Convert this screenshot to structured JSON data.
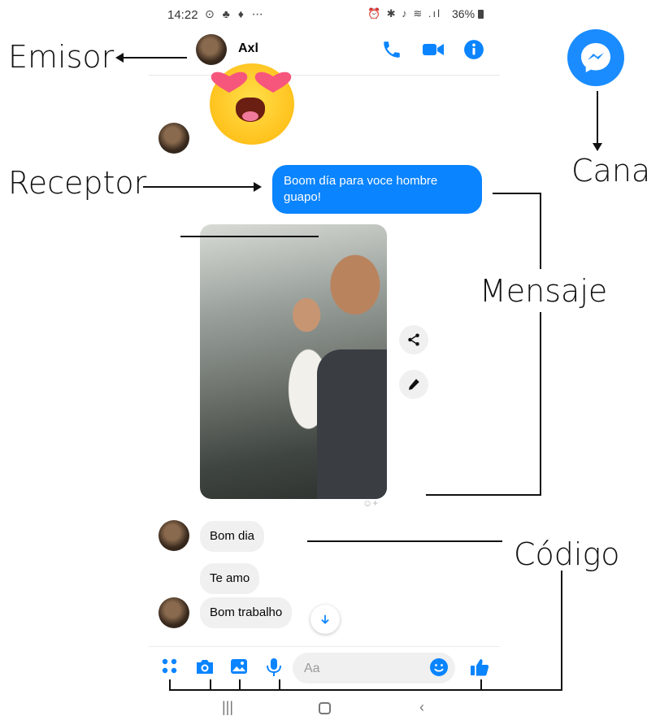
{
  "status_bar": {
    "time": "14:22",
    "left_icons": "⊙ ♣ ♦ ⋯",
    "right_icons": "⏰ ✱ ♪ ≋ .ıl",
    "battery": "36%"
  },
  "header": {
    "contact_name": "Axl",
    "icons": [
      "phone-icon",
      "video-icon",
      "info-icon"
    ]
  },
  "messages": [
    {
      "type": "sticker",
      "sender": "contact",
      "icon": "heart-eyes-emoji"
    },
    {
      "type": "text",
      "sender": "me",
      "text": "Boom día para voce hombre guapo!"
    },
    {
      "type": "photo",
      "sender": "me"
    },
    {
      "type": "text",
      "sender": "contact",
      "text": "Bom dia"
    },
    {
      "type": "text",
      "sender": "contact",
      "text": "Te amo"
    },
    {
      "type": "text",
      "sender": "contact",
      "text": "Bom trabalho"
    }
  ],
  "photo_actions": [
    "share-icon",
    "edit-icon"
  ],
  "composer": {
    "placeholder": "Aa",
    "icons": [
      "menu-dots-icon",
      "camera-icon",
      "gallery-icon",
      "microphone-icon",
      "emoji-icon",
      "thumbs-up-icon"
    ]
  },
  "annotations": {
    "emisor": "Emisor",
    "receptor": "Receptor",
    "canal": "Canal",
    "mensaje": "Mensaje",
    "codigo": "Código"
  },
  "colors": {
    "messenger_blue": "#0a84ff",
    "incoming_bubble": "#f0f0f0"
  }
}
